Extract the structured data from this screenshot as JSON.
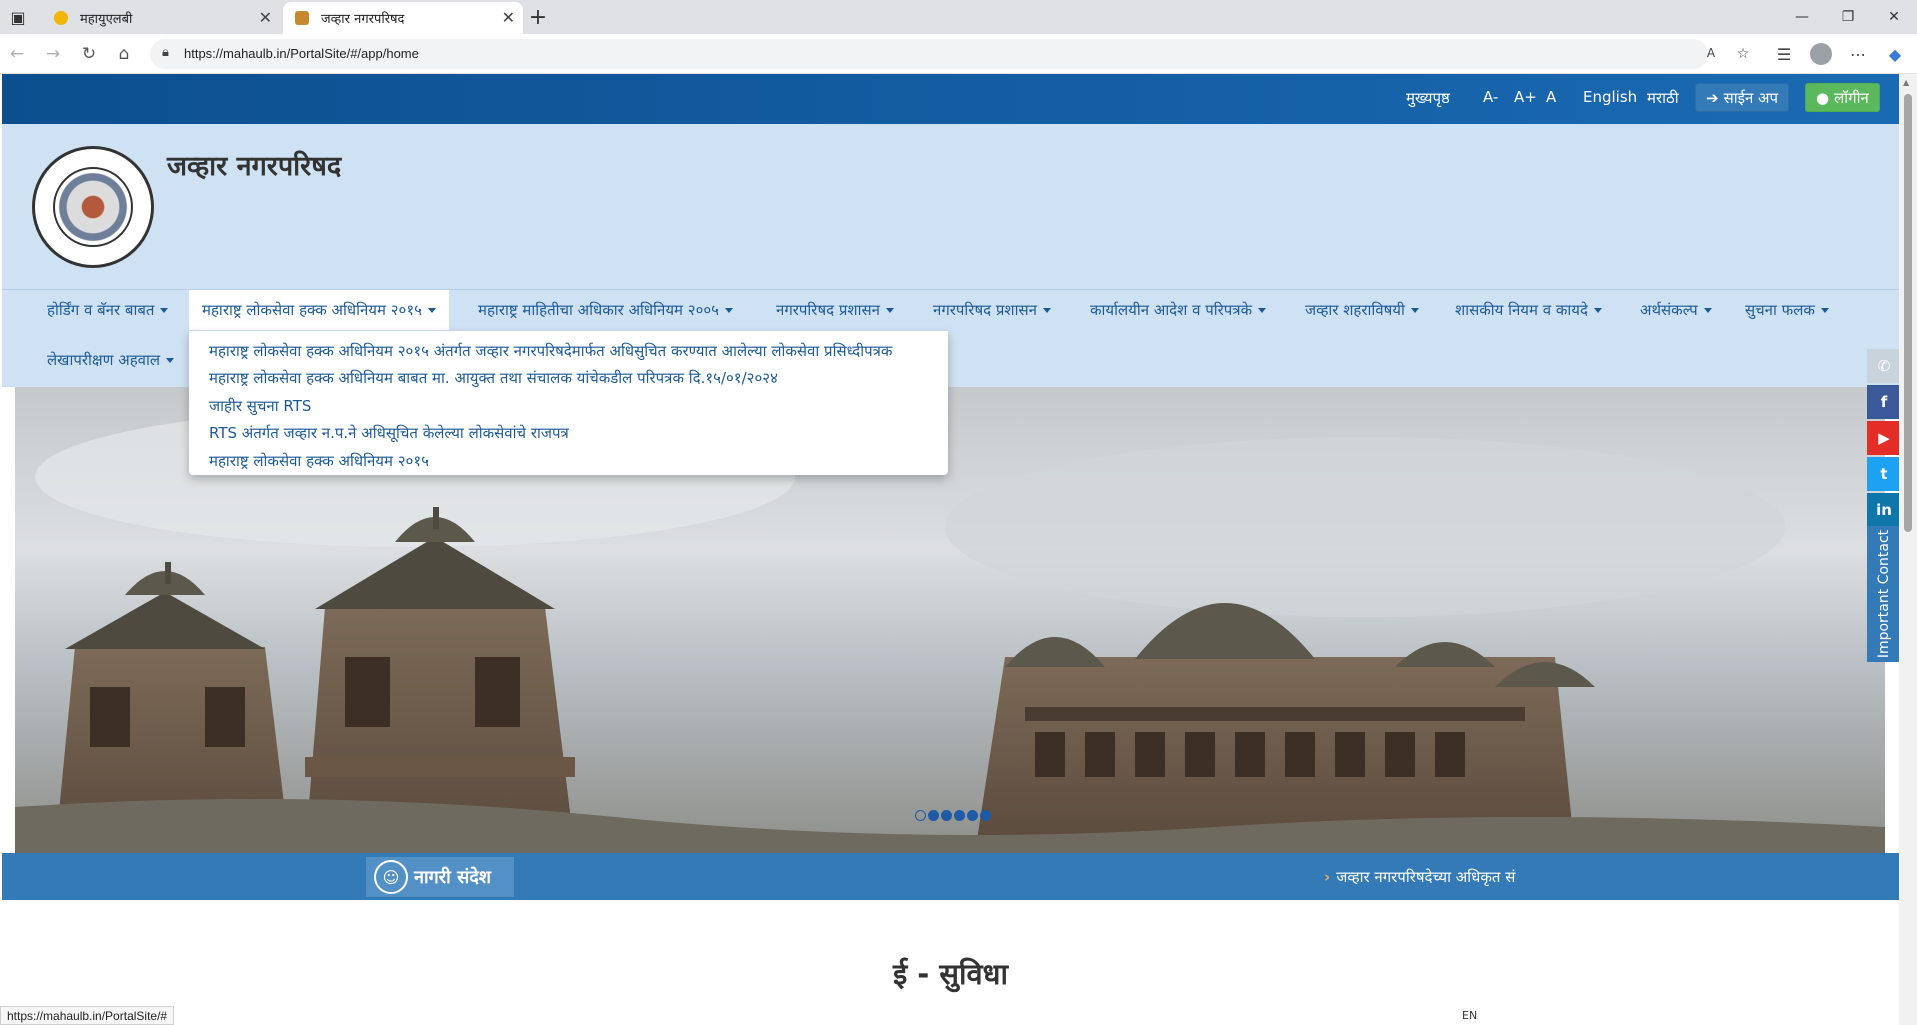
{
  "browser": {
    "tabs": [
      {
        "title": "महायुएलबी"
      },
      {
        "title": "जव्हार नगरपरिषद"
      }
    ],
    "url": "https://mahaulb.in/PortalSite/#/app/home",
    "status_url": "https://mahaulb.in/PortalSite/#",
    "read_aloud_label": "A",
    "lang_indicator": "EN"
  },
  "topbar": {
    "home": "मुख्यपृष्ठ",
    "font_decrease": "A-",
    "font_increase": "A+",
    "font_reset": "A",
    "lang_english": "English",
    "lang_marathi": "मराठी",
    "signup": "साईन अप",
    "login": "लॉगीन"
  },
  "header": {
    "title": "जव्हार नगरपरिषद"
  },
  "menu": {
    "items": [
      "होर्डिंग व बॅनर बाबत",
      "महाराष्ट्र लोकसेवा हक्क अधिनियम २०१५",
      "महाराष्ट्र माहितीचा अधिकार अधिनियम २००५",
      "नगरपरिषद प्रशासन",
      "नगरपरिषद प्रशासन",
      "कार्यालयीन आदेश व परिपत्रके",
      "जव्हार शहराविषयी",
      "शासकीय नियम व कायदे",
      "अर्थसंकल्प",
      "सुचना फलक",
      "लेखापरीक्षण अहवाल"
    ],
    "dropdown": [
      "महाराष्ट्र लोकसेवा हक्क अधिनियम २०१५ अंतर्गत जव्हार नगरपरिषदेमार्फत अधिसुचित करण्यात आलेल्या लोकसेवा प्रसिध्दीपत्रक",
      "महाराष्ट्र लोकसेवा हक्क अधिनियम बाबत मा. आयुक्त तथा संचालक यांचेकडील परिपत्रक दि.१५/०१/२०२४",
      "जाहीर सुचना RTS",
      "RTS अंतर्गत जव्हार न.प.ने अधिसूचित केलेल्या लोकसेवांचे राजपत्र",
      "महाराष्ट्र लोकसेवा हक्क अधिनियम २०१५"
    ]
  },
  "notice": {
    "label": "नागरी संदेश",
    "marquee": "जव्हार नगरपरिषदेच्या अधिकृत सं"
  },
  "section": {
    "title": "ई - सुविधा"
  },
  "side": {
    "important_contact": "Important Contact"
  },
  "colors": {
    "topbar": "#0c4f8f",
    "header_bg": "#cfe2f3",
    "link": "#1c5a96",
    "notice_bg": "#337ab7",
    "login_green": "#5cb85c"
  }
}
